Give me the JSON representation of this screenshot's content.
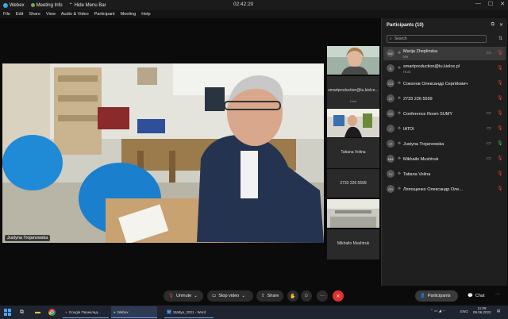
{
  "titlebar": {
    "app": "Webex",
    "meeting_info": "Meeting Info",
    "hide_menu": "Hide Menu Bar",
    "clock": "02:42:20"
  },
  "menu": [
    "File",
    "Edit",
    "Share",
    "View",
    "Audio & Video",
    "Participant",
    "Meeting",
    "Help"
  ],
  "main_video": {
    "name": "Justyna Trojanowska"
  },
  "thumbnails": [
    {
      "name": "",
      "has_video": true
    },
    {
      "name": "smartproduction@tu.kielce...",
      "sub": "Host",
      "has_video": false
    },
    {
      "name": "Tatiana Volina",
      "has_video": true
    },
    {
      "name": "2733 226 5599",
      "has_video": false
    },
    {
      "name": "Mikhailo Mushtruk",
      "has_video": true
    }
  ],
  "panel": {
    "title": "Participants (10)",
    "search_placeholder": "Search",
    "participants": [
      {
        "initials": "MZ",
        "name": "Marija Zheplinska",
        "role": "Me",
        "muted": true,
        "video": true,
        "selected": true
      },
      {
        "initials": "S",
        "name": "smartproduction@tu.kielce.pl",
        "role": "Host",
        "muted": true,
        "video": false
      },
      {
        "initials": "СО",
        "name": "Соколов Олександр Сергійович",
        "role": "",
        "muted": true,
        "video": false
      },
      {
        "initials": "27",
        "name": "2733 226 5599",
        "role": "",
        "muted": true,
        "video": false
      },
      {
        "initials": "CS",
        "name": "Conference Room SUMY",
        "role": "",
        "muted": true,
        "video": true
      },
      {
        "initials": "I",
        "name": "IATDI",
        "role": "",
        "muted": true,
        "video": true
      },
      {
        "initials": "JT",
        "name": "Justyna Trojanowska",
        "role": "",
        "muted": false,
        "video": true
      },
      {
        "initials": "MM",
        "name": "Mikhailo Mushtruk",
        "role": "",
        "muted": true,
        "video": true
      },
      {
        "initials": "TV",
        "name": "Tatiana Volina",
        "role": "",
        "muted": true,
        "video": false
      },
      {
        "initials": "ЛО",
        "name": "Ляпощенко Олександр Оле...",
        "role": "",
        "muted": true,
        "video": false
      }
    ]
  },
  "controls": {
    "unmute": "Unmute",
    "stop_video": "Stop video",
    "share": "Share",
    "participants": "Participants",
    "chat": "Chat"
  },
  "taskbar": {
    "apps": [
      "Google Переклад...",
      "Webex",
      "Stattya_2021 - Word"
    ],
    "lang": "ENG",
    "time": "11:09",
    "date": "09.06.2022"
  },
  "colors": {
    "leave": "#e23131",
    "panel": "#1f1f1f",
    "accent": "#7aa7ff",
    "muted": "#e04040"
  }
}
